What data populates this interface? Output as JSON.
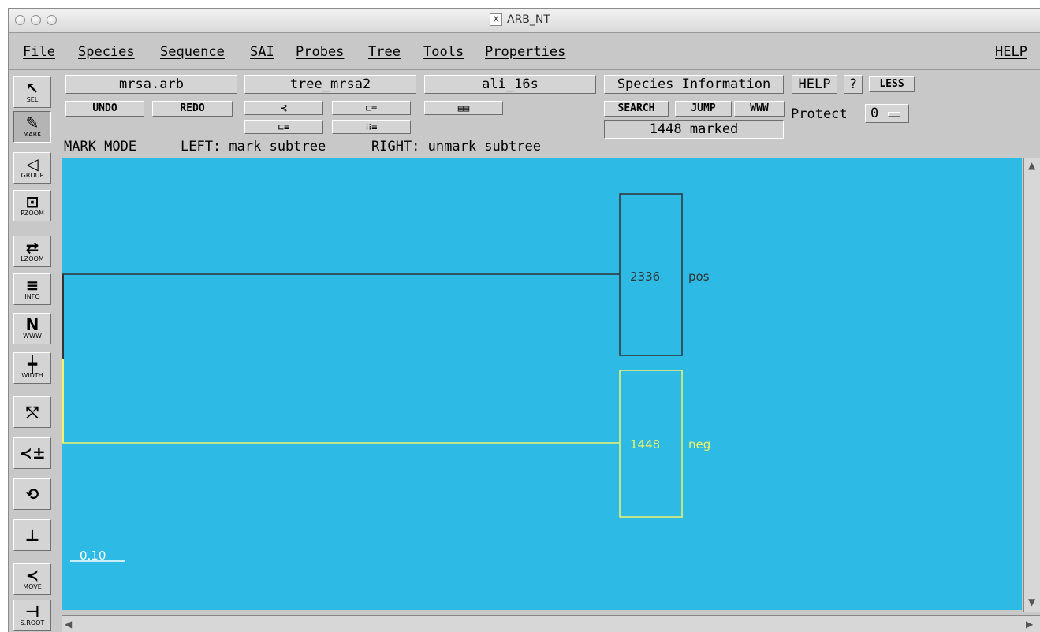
{
  "window": {
    "title": "ARB_NT"
  },
  "menubar": [
    "File",
    "Species",
    "Sequence",
    "SAI",
    "Probes",
    "Tree",
    "Tools",
    "Properties"
  ],
  "help_menu": "HELP",
  "toolbar": [
    {
      "glyph": "↖",
      "label": "SEL"
    },
    {
      "glyph": "✎",
      "label": "MARK"
    },
    {
      "glyph": "◁",
      "label": "GROUP"
    },
    {
      "glyph": "⊡",
      "label": "PZOOM"
    },
    {
      "glyph": "⇄",
      "label": "LZOOM"
    },
    {
      "glyph": "≡",
      "label": "INFO"
    },
    {
      "glyph": "N",
      "label": "WWW"
    },
    {
      "glyph": "┿",
      "label": "WIDTH"
    },
    {
      "glyph": "⤲",
      "label": ""
    },
    {
      "glyph": "≺±",
      "label": ""
    },
    {
      "glyph": "⟲",
      "label": ""
    },
    {
      "glyph": "⊥",
      "label": ""
    },
    {
      "glyph": "≺",
      "label": "MOVE"
    },
    {
      "glyph": "⊣",
      "label": "S.ROOT"
    }
  ],
  "top": {
    "db": "mrsa.arb",
    "tree": "tree_mrsa2",
    "alignment": "ali_16s",
    "undo": "UNDO",
    "redo": "REDO",
    "species_info": "Species Information",
    "help": "HELP",
    "question": "?",
    "less": "LESS",
    "search": "SEARCH",
    "jump": "JUMP",
    "www": "WWW",
    "marked": "1448 marked",
    "protect_label": "Protect",
    "protect_value": "0"
  },
  "mode_line": {
    "mode": "MARK MODE",
    "left": "LEFT: mark subtree",
    "right": "RIGHT: unmark subtree"
  },
  "tree": {
    "groups": [
      {
        "count": "2336",
        "name": "pos",
        "color": "#333333"
      },
      {
        "count": "1448",
        "name": "neg",
        "color": "#f2f268"
      }
    ],
    "scale_label": "0.10",
    "background": "#2dbbe5"
  }
}
